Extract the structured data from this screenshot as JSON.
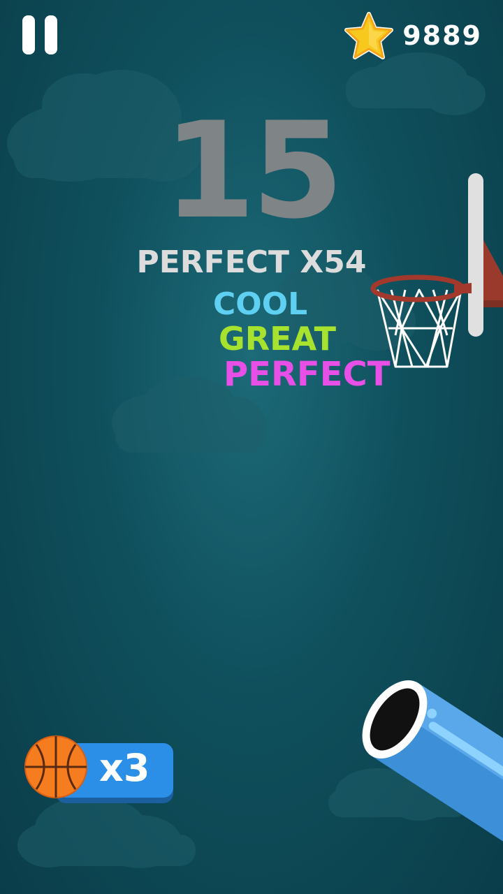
{
  "hud": {
    "coins": "9889",
    "score": "15",
    "perfect_streak": "PERFECT X54"
  },
  "ratings": {
    "cool": "COOL",
    "great": "GREAT",
    "perfect": "PERFECT"
  },
  "balls": {
    "remaining": "x3"
  },
  "colors": {
    "cool": "#5fd0f2",
    "great": "#a6e22e",
    "perfect": "#e84fe6",
    "star": "#f7c81e",
    "cannon": "#3d8fd8",
    "lives_pill": "#2b8fe8"
  }
}
